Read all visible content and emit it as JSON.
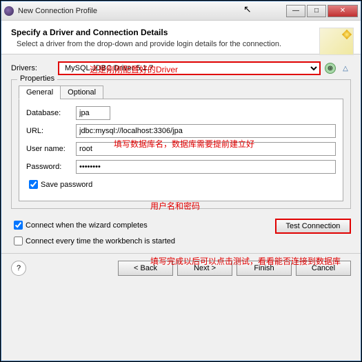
{
  "window": {
    "title": "New Connection Profile"
  },
  "header": {
    "heading": "Specify a Driver and Connection Details",
    "desc": "Select a driver from the drop-down and provide login details for the connection."
  },
  "drivers": {
    "label": "Drivers:",
    "value": "MySQL JDBC Driver 5.1.7"
  },
  "properties": {
    "legend": "Properties",
    "tabs": {
      "general": "General",
      "optional": "Optional"
    },
    "database_label": "Database:",
    "database_value": "jpa",
    "url_label": "URL:",
    "url_value": "jdbc:mysql://localhost:3306/jpa",
    "username_label": "User name:",
    "username_value": "root",
    "password_label": "Password:",
    "password_value": "••••••••",
    "save_password_label": "Save password"
  },
  "options": {
    "connect_when_complete": "Connect when the wizard completes",
    "connect_every_start": "Connect every time the workbench is started",
    "test_connection": "Test Connection"
  },
  "buttons": {
    "back": "< Back",
    "next": "Next >",
    "finish": "Finish",
    "cancel": "Cancel",
    "help": "?"
  },
  "annotations": {
    "a1": "这是刚刚配置好的Driver",
    "a2": "填写数据库名，数据库需要提前建立好",
    "a3": "用户名和密码",
    "a4": "填写完成以后可以点击测试，看看能否连接到数据库"
  },
  "winbtns": {
    "min": "—",
    "max": "□",
    "close": "✕"
  },
  "icons": {
    "add": "⊕",
    "tri": "△"
  }
}
